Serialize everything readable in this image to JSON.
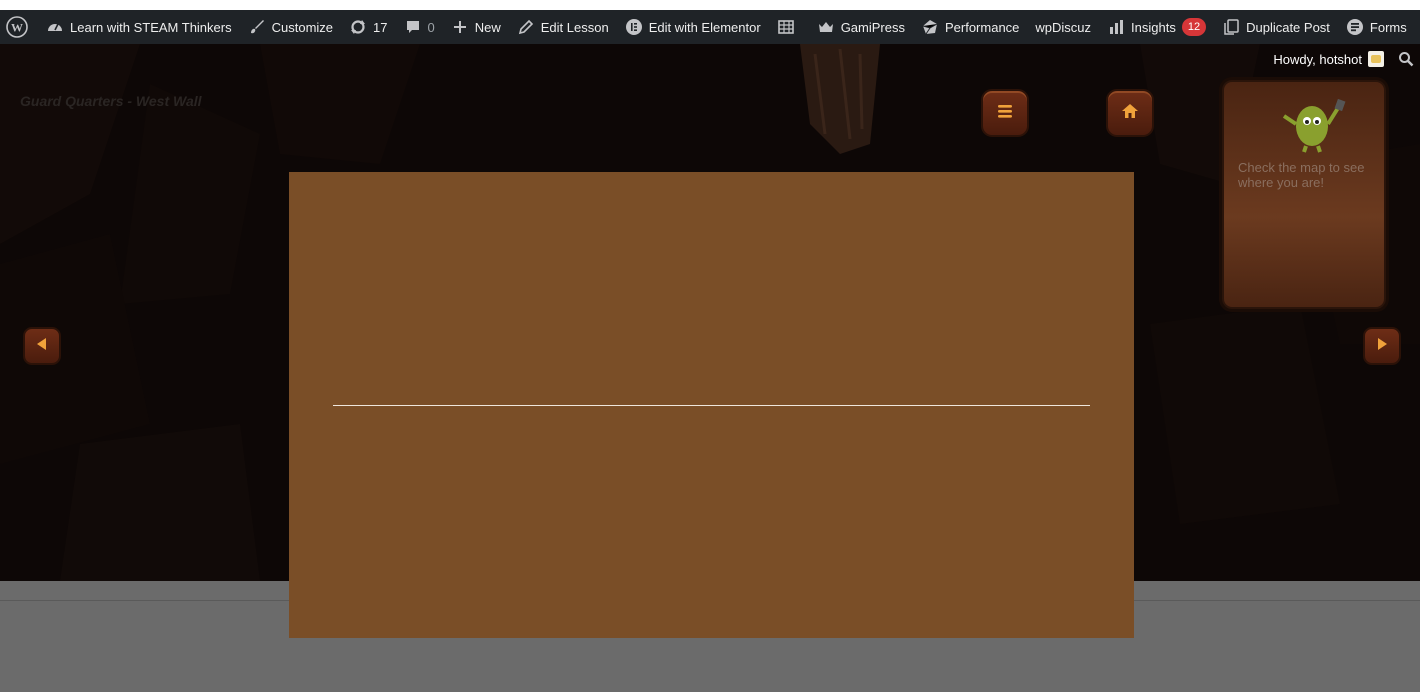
{
  "adminbar": {
    "items": [
      {
        "id": "site",
        "label": "Learn with STEAM Thinkers",
        "icon": "dashboard-icon"
      },
      {
        "id": "customize",
        "label": "Customize",
        "icon": "brush-icon"
      },
      {
        "id": "updates",
        "label": "17",
        "icon": "refresh-icon"
      },
      {
        "id": "comments",
        "label": "0",
        "icon": "comment-icon"
      },
      {
        "id": "new",
        "label": "New",
        "icon": "plus-icon"
      },
      {
        "id": "edit-lesson",
        "label": "Edit Lesson",
        "icon": "pencil-icon"
      },
      {
        "id": "elementor",
        "label": "Edit with Elementor",
        "icon": "elementor-icon"
      },
      {
        "id": "table",
        "label": "",
        "icon": "table-icon"
      },
      {
        "id": "gamipress",
        "label": "GamiPress",
        "icon": "crown-icon"
      },
      {
        "id": "performance",
        "label": "Performance",
        "icon": "cube-icon"
      },
      {
        "id": "wpdiscuz",
        "label": "wpDiscuz",
        "icon": ""
      },
      {
        "id": "insights",
        "label": "Insights",
        "icon": "bar-chart-icon",
        "badge": "12"
      },
      {
        "id": "duplicate",
        "label": "Duplicate Post",
        "icon": "copy-icon"
      },
      {
        "id": "forms",
        "label": "Forms",
        "icon": "forms-icon"
      }
    ],
    "howdy": "Howdy, hotshot"
  },
  "scene": {
    "title": "Guard Quarters - West Wall",
    "hint": "Check the map to see where you are!"
  },
  "colors": {
    "modal_bg": "#7a4e27",
    "adminbar_bg": "#1f2327",
    "badge": "#d63638"
  }
}
